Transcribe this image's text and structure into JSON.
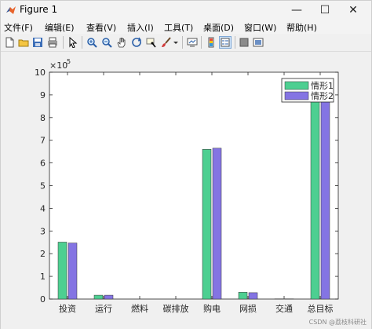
{
  "window": {
    "title": "Figure 1",
    "controls": {
      "minimize": "—",
      "maximize": "☐",
      "close": "✕"
    }
  },
  "menu": {
    "items": [
      "文件(F)",
      "编辑(E)",
      "查看(V)",
      "插入(I)",
      "工具(T)",
      "桌面(D)",
      "窗口(W)",
      "帮助(H)"
    ]
  },
  "toolbar": {
    "buttons": [
      "new-figure-icon",
      "open-file-icon",
      "save-icon",
      "print-icon",
      "edit-plot-arrow-icon",
      "zoom-in-icon",
      "zoom-out-icon",
      "pan-hand-icon",
      "rotate-3d-icon",
      "data-cursor-icon",
      "brush-icon",
      "brush-dropdown-icon",
      "link-plot-icon",
      "colorbar-icon",
      "legend-icon",
      "hide-plot-tools-icon",
      "show-plot-tools-icon"
    ]
  },
  "colors": {
    "series1": "#4dcf91",
    "series2": "#8474e3",
    "axes": "#262626",
    "plot_bg": "#ffffff",
    "figure_bg": "#f0f0f0"
  },
  "chart_data": {
    "type": "bar",
    "categories": [
      "投资",
      "运行",
      "燃料",
      "碳排放",
      "购电",
      "网损",
      "交通",
      "总目标"
    ],
    "series": [
      {
        "name": "情形1",
        "values": [
          251000,
          17000,
          0,
          0,
          660000,
          30000,
          1000,
          905000
        ]
      },
      {
        "name": "情形2",
        "values": [
          247000,
          17000,
          0,
          0,
          665000,
          28000,
          1000,
          905000
        ]
      }
    ],
    "ylim": [
      0,
      1000000
    ],
    "yticks": [
      "0",
      "1",
      "2",
      "3",
      "4",
      "5",
      "6",
      "7",
      "8",
      "9",
      "10"
    ],
    "y_exponent_label": "×10",
    "y_exponent_power": "5",
    "legend_position": "top-right",
    "grid": false
  },
  "watermark": "CSDN @荔枝科研社"
}
